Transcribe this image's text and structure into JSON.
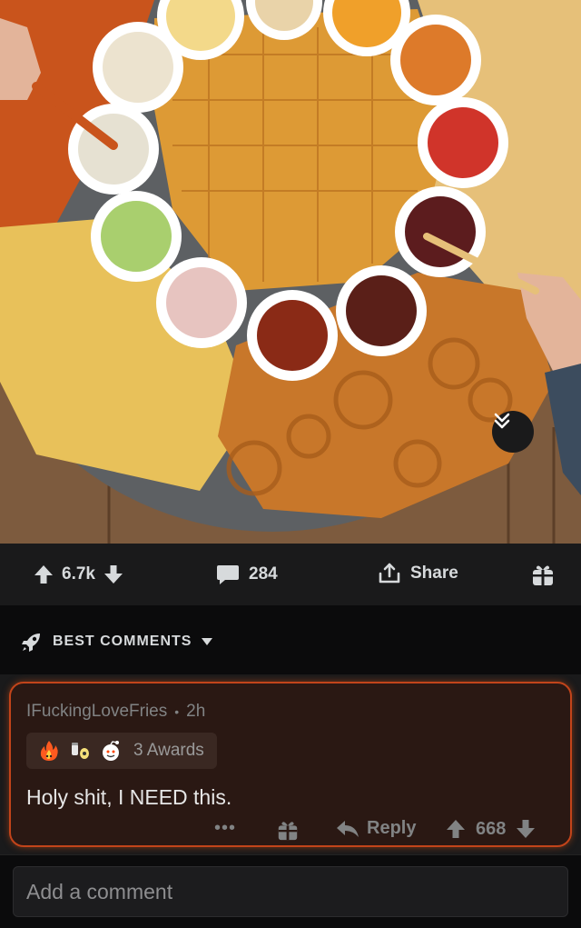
{
  "post": {
    "image_alt": "",
    "collapse_icon": "double-chevron-down-icon"
  },
  "action_bar": {
    "score": "6.7k",
    "comment_count": "284",
    "share_label": "Share"
  },
  "comments_header": {
    "label": "BEST COMMENTS"
  },
  "comment": {
    "author": "IFuckingLoveFries",
    "age": "2h",
    "awards_label": "3 Awards",
    "body": "Holy shit, I NEED this.",
    "more": "•••",
    "reply_label": "Reply",
    "score": "668"
  },
  "composer": {
    "placeholder": "Add a comment"
  },
  "colors": {
    "accent_border": "#c2441a",
    "comment_bg": "#2a1813",
    "bar_bg": "#1a1a1b",
    "text_muted": "#818384"
  }
}
